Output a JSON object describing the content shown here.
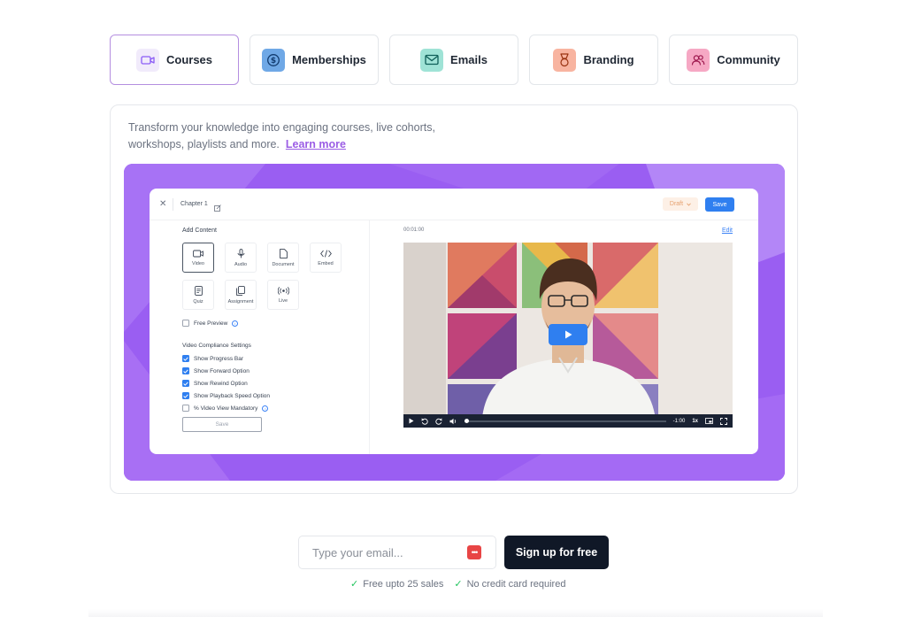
{
  "tabs": [
    {
      "label": "Courses",
      "icon": "video-camera-icon",
      "color": "#8b5cf6",
      "bg": "#f1ebfb",
      "active": true
    },
    {
      "label": "Memberships",
      "icon": "dollar-coin-icon",
      "color": "#1f5fb4",
      "bg": "#6fa8e6",
      "active": false
    },
    {
      "label": "Emails",
      "icon": "mail-icon",
      "color": "#0f766e",
      "bg": "#9fe3d6",
      "active": false
    },
    {
      "label": "Branding",
      "icon": "medal-icon",
      "color": "#b45309",
      "bg": "#f8b4a0",
      "active": false
    },
    {
      "label": "Community",
      "icon": "users-icon",
      "color": "#be185d",
      "bg": "#f6a8c4",
      "active": false
    }
  ],
  "description": {
    "text": "Transform your knowledge into engaging courses, live cohorts, workshops, playlists and more.",
    "link_label": "Learn more"
  },
  "editor": {
    "chapter_title": "Chapter 1",
    "status": "Draft",
    "save_label": "Save",
    "add_content_title": "Add Content",
    "content_types": [
      {
        "label": "Video",
        "icon": "video-icon",
        "selected": true
      },
      {
        "label": "Audio",
        "icon": "microphone-icon",
        "selected": false
      },
      {
        "label": "Document",
        "icon": "document-icon",
        "selected": false
      },
      {
        "label": "Embed",
        "icon": "code-icon",
        "selected": false
      },
      {
        "label": "Quiz",
        "icon": "quiz-icon",
        "selected": false
      },
      {
        "label": "Assignment",
        "icon": "assignment-icon",
        "selected": false
      },
      {
        "label": "Live",
        "icon": "broadcast-icon",
        "selected": false
      }
    ],
    "free_preview_label": "Free Preview",
    "compliance_title": "Video Compliance Settings",
    "compliance_options": [
      {
        "label": "Show Progress Bar",
        "checked": true
      },
      {
        "label": "Show Forward Option",
        "checked": true
      },
      {
        "label": "Show Rewind Option",
        "checked": true
      },
      {
        "label": "Show Playback Speed Option",
        "checked": true
      },
      {
        "label": "% Video View Mandatory",
        "checked": false
      }
    ],
    "bottom_save_label": "Save",
    "video": {
      "timestamp": "00:01:00",
      "edit_label": "Edit",
      "remaining": "-1:00",
      "speed": "1x"
    }
  },
  "signup": {
    "email_placeholder": "Type your email...",
    "button_label": "Sign up for free",
    "perks": [
      "Free upto 25 sales",
      "No credit card required"
    ]
  }
}
